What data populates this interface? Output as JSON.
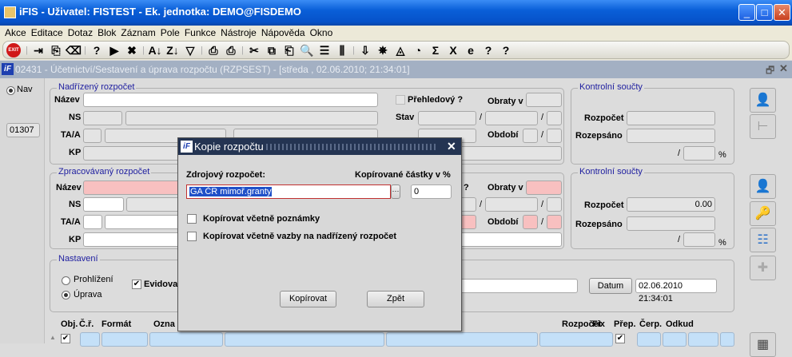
{
  "window": {
    "title": "iFIS - Uživatel: FISTEST - Ek. jednotka: DEMO@FISDEMO",
    "minimize": "_",
    "maximize": "□",
    "close": "✕"
  },
  "menu": [
    "Akce",
    "Editace",
    "Dotaz",
    "Blok",
    "Záznam",
    "Pole",
    "Funkce",
    "Nástroje",
    "Nápověda",
    "Okno"
  ],
  "toolbar": [
    {
      "icon": "exit-icon",
      "glyph": "EXIT"
    },
    {
      "sep": true
    },
    {
      "icon": "insert-record-icon",
      "glyph": "⇥"
    },
    {
      "icon": "duplicate-record-icon",
      "glyph": "⎘"
    },
    {
      "icon": "delete-record-icon",
      "glyph": "⌫"
    },
    {
      "sep": true
    },
    {
      "icon": "query-enter-icon",
      "glyph": "?"
    },
    {
      "icon": "query-execute-icon",
      "glyph": "▶"
    },
    {
      "icon": "query-cancel-icon",
      "glyph": "✖"
    },
    {
      "sep": true
    },
    {
      "icon": "sort-ascending-icon",
      "glyph": "A↓"
    },
    {
      "icon": "sort-descending-icon",
      "glyph": "Z↓"
    },
    {
      "icon": "filter-icon",
      "glyph": "▽"
    },
    {
      "sep": true
    },
    {
      "icon": "print-icon",
      "glyph": "⎙"
    },
    {
      "icon": "print-setup-icon",
      "glyph": "⎙"
    },
    {
      "sep": true
    },
    {
      "icon": "cut-icon",
      "glyph": "✂"
    },
    {
      "icon": "copy-icon",
      "glyph": "⧉"
    },
    {
      "icon": "paste-icon",
      "glyph": "⎗"
    },
    {
      "icon": "search-icon",
      "glyph": "🔍"
    },
    {
      "icon": "list-icon",
      "glyph": "☰"
    },
    {
      "icon": "columns-icon",
      "glyph": "⫼"
    },
    {
      "sep": true
    },
    {
      "icon": "import-icon",
      "glyph": "⇩"
    },
    {
      "icon": "settings-wheel-icon",
      "glyph": "✵"
    },
    {
      "icon": "eye-icon",
      "glyph": "◬"
    },
    {
      "icon": "calculator-icon",
      "glyph": "◔"
    },
    {
      "icon": "sum-icon",
      "glyph": "Σ"
    },
    {
      "icon": "excel-icon",
      "glyph": "X"
    },
    {
      "icon": "internet-explorer-icon",
      "glyph": "e"
    },
    {
      "icon": "help-icon",
      "glyph": "?"
    },
    {
      "icon": "context-help-icon",
      "glyph": "?"
    }
  ],
  "form": {
    "title": "02431 - Účetnictví/Sestavení a úprava rozpočtu (RZPSEST) - [středa , 02.06.2010; 21:34:01]",
    "restore": "🗗",
    "close": "✕",
    "logo": "iF"
  },
  "left": {
    "nav": "Nav",
    "record": "01307"
  },
  "parent": {
    "group": "Nadřízený rozpočet",
    "nazev": "Název",
    "ns": "NS",
    "taa": "TA/A",
    "kp": "KP",
    "prehledovy": "Přehledový ?",
    "obraty": "Obraty v",
    "stav": "Stav",
    "obdobi": "Období",
    "slash": "/"
  },
  "parent_ctrl": {
    "group": "Kontrolní součty",
    "rozpocet": "Rozpočet",
    "rozepsano": "Rozepsáno",
    "slash": "/",
    "pct": "%"
  },
  "proc": {
    "group": "Zpracovávaný rozpočet",
    "nazev": "Název",
    "ns": "NS",
    "taa": "TA/A",
    "kp": "KP",
    "q": "?",
    "obraty": "Obraty v",
    "obdobi": "Období",
    "slash": "/"
  },
  "proc_ctrl": {
    "group": "Kontrolní součty",
    "rozpocet": "Rozpočet",
    "rozpocet_value": "0.00",
    "rozepsano": "Rozepsáno",
    "slash": "/",
    "pct": "%"
  },
  "settings": {
    "group": "Nastavení",
    "prohlizeni": "Prohlížení",
    "uprava": "Úprava",
    "evidova": "Evidova",
    "datum": "Datum",
    "date_value": "02.06.2010 21:34:01",
    "mode": "Úprava"
  },
  "table": {
    "headers": {
      "obj": "Obj.",
      "cr": "Č.ř.",
      "format": "Formát",
      "ozna": "Ozna",
      "rozpocet": "Rozpočet",
      "fix": "Fix",
      "prep": "Přep.",
      "cerp": "Čerp.",
      "odkud": "Odkud"
    }
  },
  "dialog": {
    "title": "Kopie rozpočtu",
    "close": "✕",
    "logo": "iF",
    "source_label": "Zdrojový rozpočet:",
    "source_value": "GA ČR mimoř.granty",
    "lov": "···",
    "pct_label": "Kopírované částky v %",
    "pct_value": "0",
    "chk1": "Kopírovat včetně poznámky",
    "chk2": "Kopírovat včetně vazby na nadřízený rozpočet",
    "copy": "Kopírovat",
    "back": "Zpět"
  }
}
